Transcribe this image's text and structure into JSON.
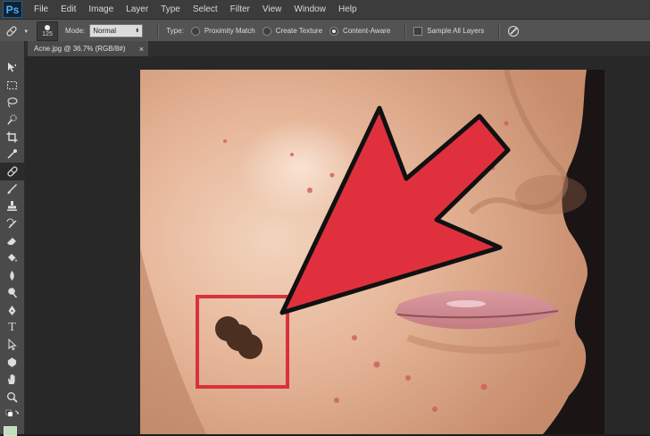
{
  "app": {
    "logo": "Ps"
  },
  "menu": [
    "File",
    "Edit",
    "Image",
    "Layer",
    "Type",
    "Select",
    "Filter",
    "View",
    "Window",
    "Help"
  ],
  "options_bar": {
    "brush_size": "125",
    "mode_label": "Mode:",
    "mode_value": "Normal",
    "type_label": "Type:",
    "type_options": [
      {
        "label": "Proximity Match",
        "checked": false
      },
      {
        "label": "Create Texture",
        "checked": false
      },
      {
        "label": "Content-Aware",
        "checked": true
      }
    ],
    "sample_all_layers_label": "Sample All Layers",
    "sample_all_layers_checked": false
  },
  "document_tab": {
    "title": "Acne.jpg @ 36.7% (RGB/8#)",
    "close": "×"
  },
  "tools": [
    "move-tool",
    "marquee-tool",
    "lasso-tool",
    "quick-selection-tool",
    "crop-tool",
    "eyedropper-tool",
    "spot-healing-brush-tool",
    "brush-tool",
    "clone-stamp-tool",
    "history-brush-tool",
    "eraser-tool",
    "paint-bucket-tool",
    "blur-tool",
    "dodge-tool",
    "pen-tool",
    "type-tool",
    "path-selection-tool",
    "custom-shape-tool",
    "hand-tool",
    "zoom-tool",
    "default-colors-icon"
  ],
  "tool_text": {
    "type": "T"
  },
  "colors": {
    "menu_bg": "#3c3c3c",
    "options_bg": "#535353",
    "canvas_bg": "#282828",
    "highlight_red": "#d8323c",
    "arrow_red": "#e0303e"
  }
}
